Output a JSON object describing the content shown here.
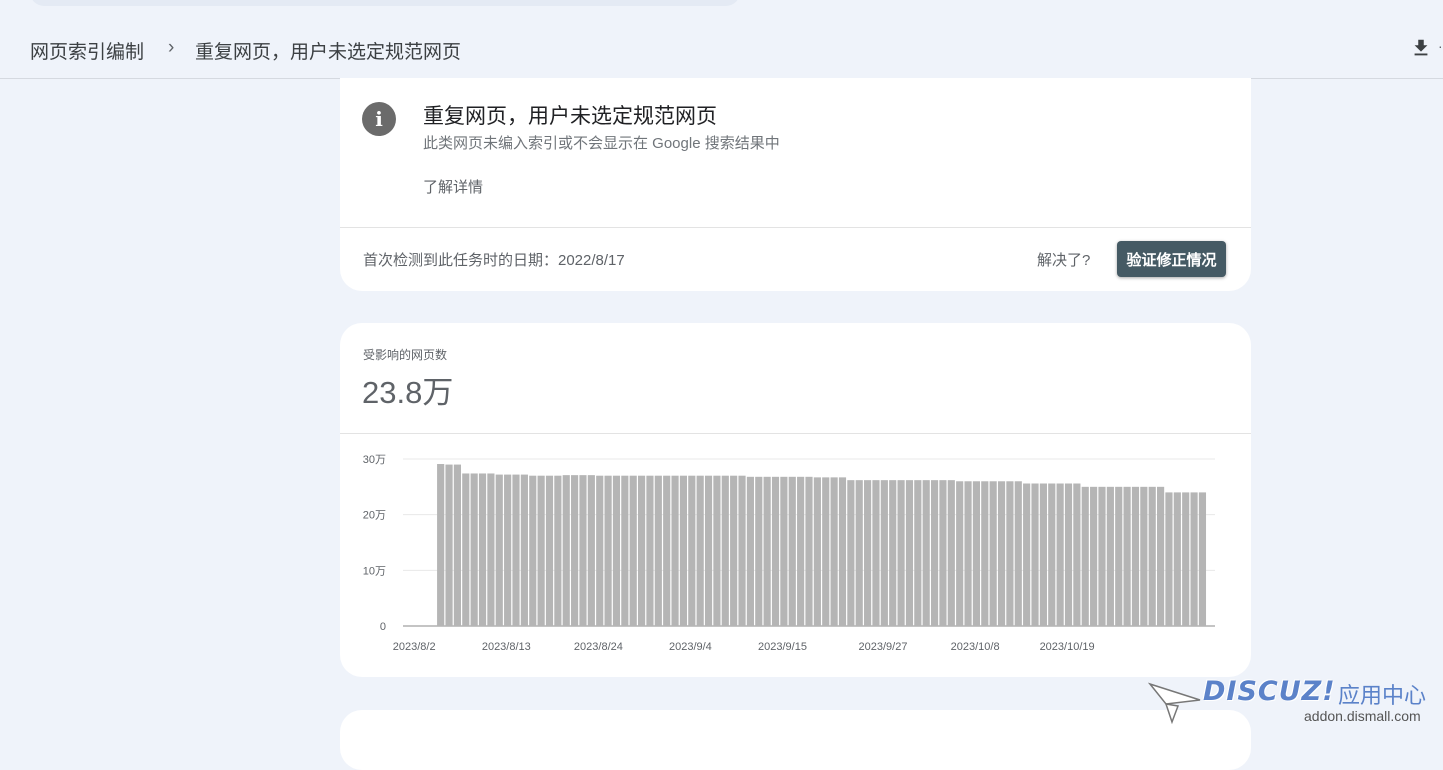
{
  "header": {
    "breadcrumb_root": "网页索引编制",
    "breadcrumb_sep": "›",
    "breadcrumb_current": "重复网页，用户未选定规范网页",
    "download_icon": "download-icon"
  },
  "issue": {
    "icon": "info-icon",
    "title": "重复网页，用户未选定规范网页",
    "description": "此类网页未编入索引或不会显示在 Google 搜索结果中",
    "learn_more": "了解详情",
    "first_detected": "首次检测到此任务时的日期：2022/8/17",
    "resolved_question": "解决了?",
    "validate_button": "验证修正情况"
  },
  "stats": {
    "label": "受影响的网页数",
    "value": "23.8万"
  },
  "chart_data": {
    "type": "bar",
    "ylim": [
      0,
      300000
    ],
    "yticks": [
      "0",
      "10万",
      "20万",
      "30万"
    ],
    "xtick_labels": [
      "2023/8/2",
      "2023/8/13",
      "2023/8/24",
      "2023/9/4",
      "2023/9/15",
      "2023/9/27",
      "2023/10/8",
      "2023/10/19"
    ],
    "bar_color": "#b5b5b5",
    "values": [
      0,
      0,
      0,
      0,
      291000,
      290000,
      290000,
      274000,
      274000,
      274000,
      274000,
      272000,
      272000,
      272000,
      272000,
      270000,
      270000,
      270000,
      270000,
      271000,
      271000,
      271000,
      271000,
      270000,
      270000,
      270000,
      270000,
      270000,
      270000,
      270000,
      270000,
      270000,
      270000,
      270000,
      270000,
      270000,
      270000,
      270000,
      270000,
      270000,
      270000,
      268000,
      268000,
      268000,
      268000,
      268000,
      268000,
      268000,
      268000,
      267000,
      267000,
      267000,
      267000,
      262000,
      262000,
      262000,
      262000,
      262000,
      262000,
      262000,
      262000,
      262000,
      262000,
      262000,
      262000,
      262000,
      260000,
      260000,
      260000,
      260000,
      260000,
      260000,
      260000,
      260000,
      256000,
      256000,
      256000,
      256000,
      256000,
      256000,
      256000,
      250000,
      250000,
      250000,
      250000,
      250000,
      250000,
      250000,
      250000,
      250000,
      250000,
      240000,
      240000,
      240000,
      240000,
      240000
    ]
  },
  "watermark": {
    "logo": "DISCUZ!",
    "suffix": "应用中心",
    "url": "addon.dismall.com"
  }
}
